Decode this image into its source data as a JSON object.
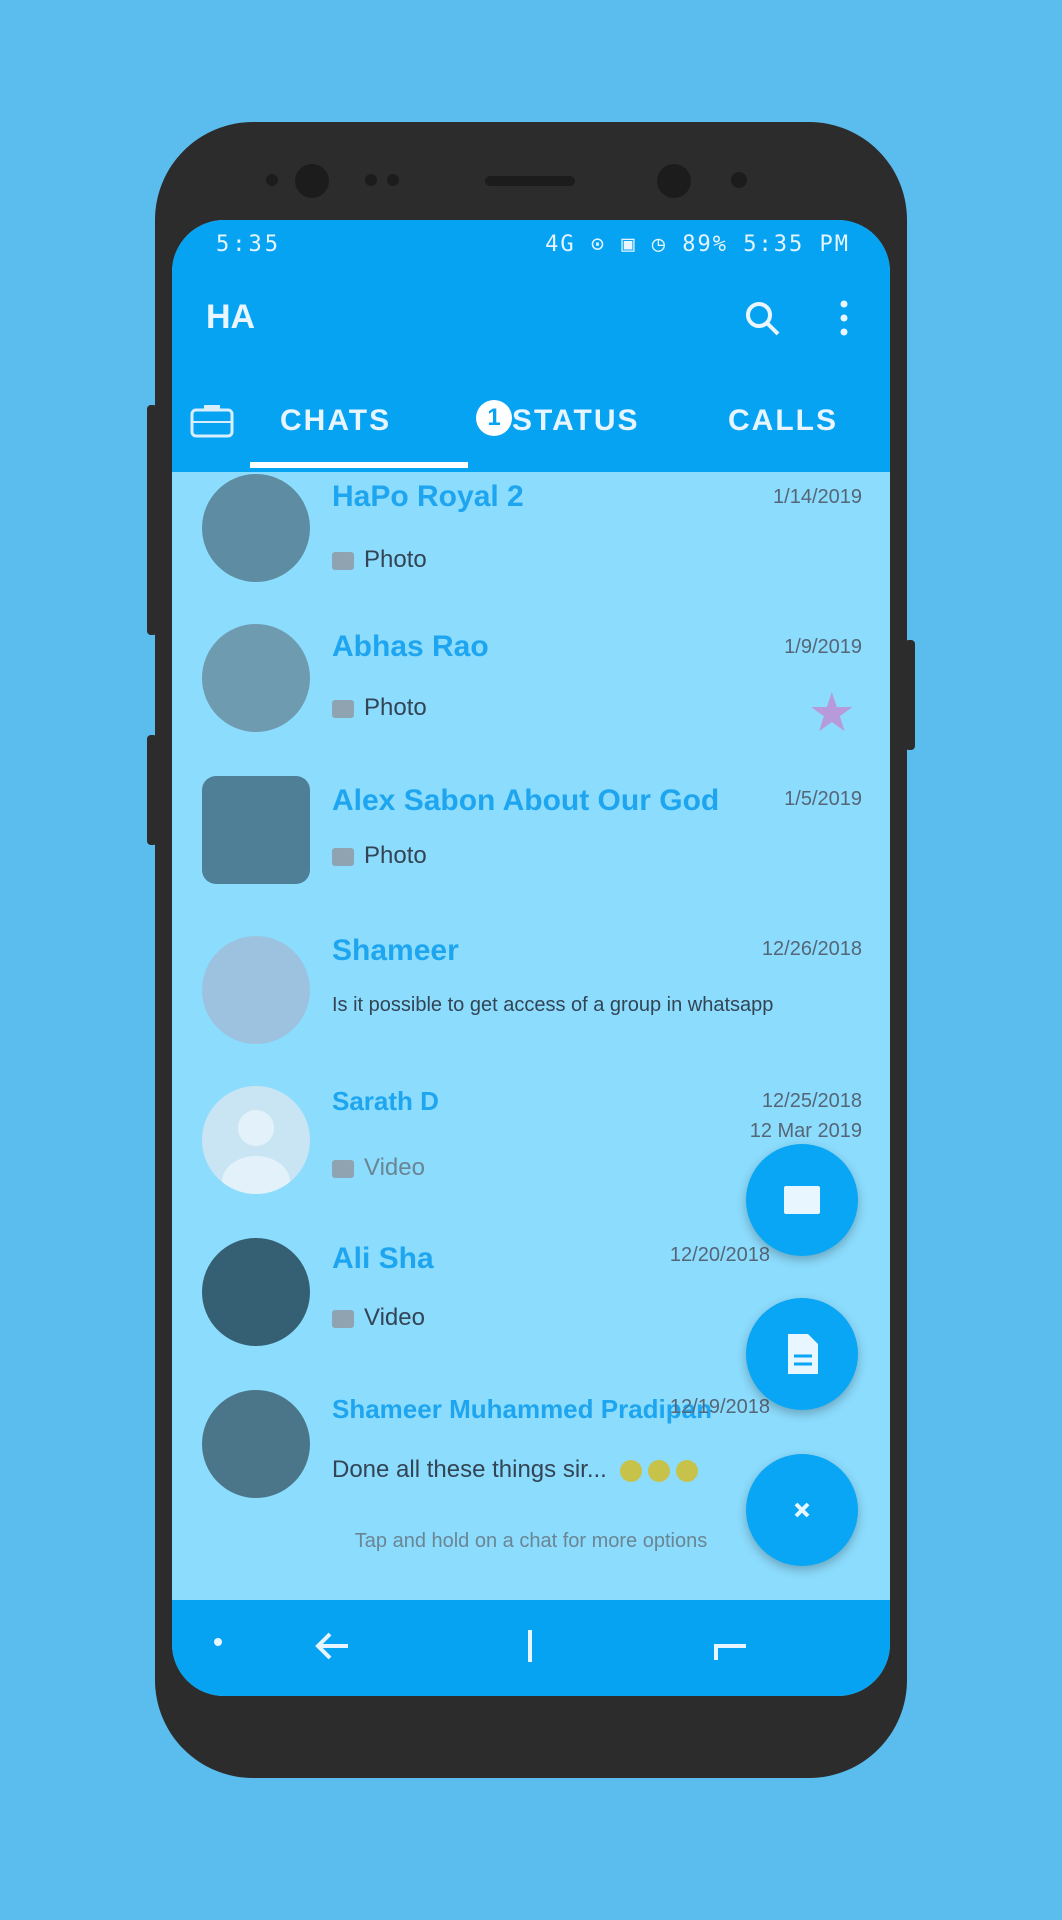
{
  "status_bar": {
    "left": "5:35",
    "right": "4G ⊙ ▣ ◷ 89% 5:35 PM"
  },
  "app_bar": {
    "title": "HA",
    "search_icon": "search-icon",
    "more_icon": "more-vert-icon"
  },
  "tabs": {
    "camera_icon": "camera-icon",
    "chats": "CHATS",
    "chats_badge": "1",
    "status": "STATUS",
    "calls": "CALLS"
  },
  "chats": [
    {
      "name": "HaPo Royal 2",
      "time": "1/14/2019",
      "message": "Photo",
      "msg_icon": "photo-icon",
      "avatar_color": "#5e8da3"
    },
    {
      "name": "Abhas Rao",
      "time": "1/9/2019",
      "message": "Photo",
      "msg_icon": "photo-icon",
      "avatar_color": "#6f9bb0",
      "starred": true
    },
    {
      "name": "Alex Sabon About Our God",
      "time": "1/5/2019",
      "message": "Photo",
      "msg_icon": "photo-icon",
      "avatar_color": "#4f7f96"
    },
    {
      "name": "Shameer",
      "time": "12/26/2018",
      "message": "Is it possible to get access of a group in whatsapp",
      "avatar_color": "#9cc2e0"
    },
    {
      "name": "Sarath D",
      "time": "12/25/2018",
      "time2": "12 Mar 2019",
      "message": "Video",
      "msg_icon": "video-icon",
      "avatar_color": "#c9e5f3"
    },
    {
      "name": "Ali Sha",
      "time": "12/20/2018",
      "message": "Video",
      "msg_icon": "video-icon",
      "avatar_color": "#355f72"
    },
    {
      "name": "Shameer Muhammed Pradipan",
      "time": "12/19/2018",
      "message": "Done all these things sir...",
      "avatar_color": "#4b7588"
    }
  ],
  "footer_text": "Tap and hold on a chat for more options",
  "fabs": {
    "message_icon": "message-icon",
    "document_icon": "document-icon",
    "close_icon": "close-icon"
  },
  "nav_bar": {
    "left_icon": "dot-icon",
    "back_icon": "back-arrow-icon",
    "home_icon": "home-icon",
    "recents_icon": "recents-icon"
  }
}
